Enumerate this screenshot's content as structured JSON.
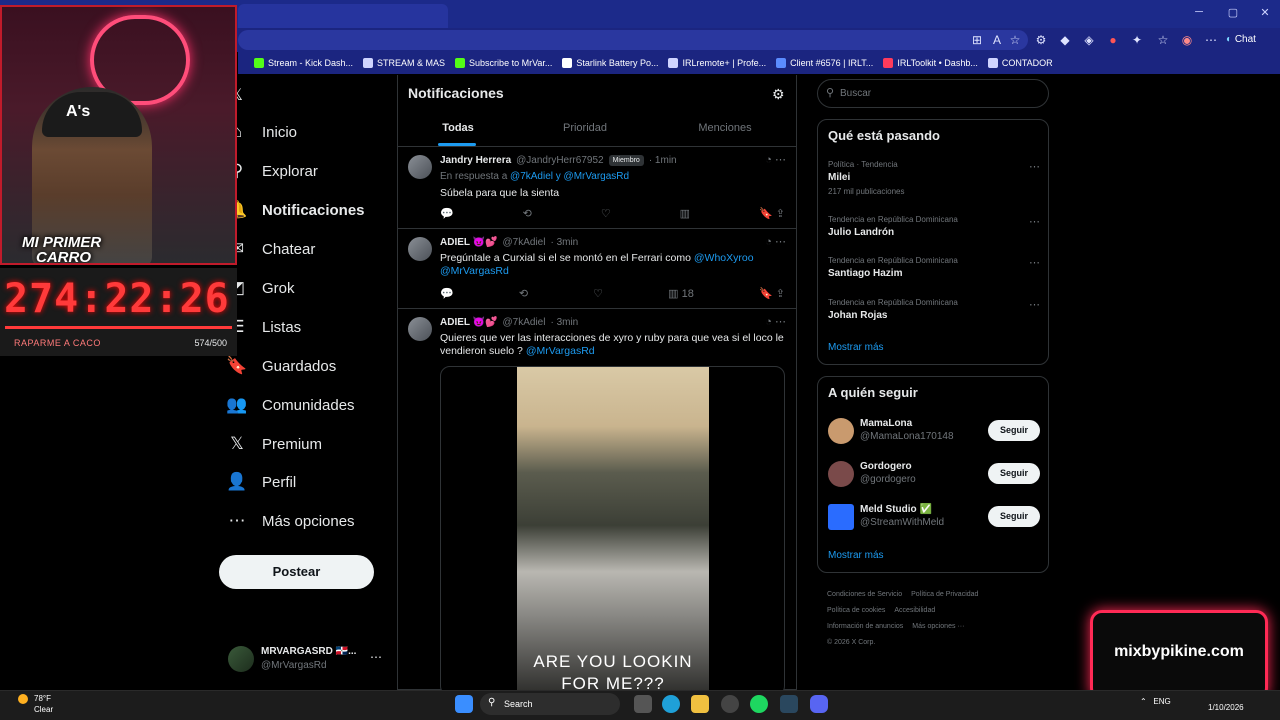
{
  "browser": {
    "chat_label": "Chat",
    "bookmarks": [
      {
        "label": "Stream - Kick Dash...",
        "color": "#53fc18"
      },
      {
        "label": "STREAM & MAS",
        "color": "#cfd4ff"
      },
      {
        "label": "Subscribe to MrVar...",
        "color": "#53fc18"
      },
      {
        "label": "Starlink Battery Po...",
        "color": "#ffffff"
      },
      {
        "label": "IRLremote+ | Profe...",
        "color": "#cfd4ff"
      },
      {
        "label": "Client #6576 | IRLT...",
        "color": "#5b8cff"
      },
      {
        "label": "IRLToolkit • Dashb...",
        "color": "#ff3b5c"
      },
      {
        "label": "CONTADOR",
        "color": "#cfd4ff"
      }
    ]
  },
  "nav": {
    "items": [
      {
        "label": "Inicio",
        "icon": "home-icon",
        "glyph": "⌂"
      },
      {
        "label": "Explorar",
        "icon": "search-icon",
        "glyph": "⚲"
      },
      {
        "label": "Notificaciones",
        "icon": "bell-icon",
        "glyph": "🔔"
      },
      {
        "label": "Chatear",
        "icon": "envelope-icon",
        "glyph": "✉"
      },
      {
        "label": "Grok",
        "icon": "grok-icon",
        "glyph": "◩"
      },
      {
        "label": "Listas",
        "icon": "list-icon",
        "glyph": "☰"
      },
      {
        "label": "Guardados",
        "icon": "bookmark-icon",
        "glyph": "🔖"
      },
      {
        "label": "Comunidades",
        "icon": "people-icon",
        "glyph": "👥"
      },
      {
        "label": "Premium",
        "icon": "x-logo-icon",
        "glyph": "𝕏"
      },
      {
        "label": "Perfil",
        "icon": "person-icon",
        "glyph": "👤"
      },
      {
        "label": "Más opciones",
        "icon": "more-circle-icon",
        "glyph": "⋯"
      }
    ],
    "post_label": "Postear",
    "account": {
      "name": "MRVARGASRD 🇩🇴...",
      "handle": "@MrVargasRd"
    }
  },
  "notifications": {
    "title": "Notificaciones",
    "tabs": [
      "Todas",
      "Prioridad",
      "Menciones"
    ],
    "posts": [
      {
        "name": "Jandry Herrera",
        "handle": "@JandryHerr67952",
        "badge": "Miembro",
        "time": "1min",
        "reply_prefix": "En respuesta a",
        "reply_users": "@7kAdiel y @MrVargasRd",
        "text": "Súbela para que la sienta",
        "views": ""
      },
      {
        "name": "ADIEL 😈💕",
        "handle": "@7kAdiel",
        "time": "3min",
        "text": "Pregúntale a Curxial si el se montó en el Ferrari como",
        "mentions": "@WhoXyroo @MrVargasRd",
        "views": "18"
      },
      {
        "name": "ADIEL 😈💕",
        "handle": "@7kAdiel",
        "time": "3min",
        "text": "Quieres que ver las interacciones de xyro y ruby para que vea si el loco le vendieron suelo ?",
        "mentions": "@MrVargasRd",
        "media_caption": "ARE YOU LOOKIN FOR ME???"
      }
    ]
  },
  "right": {
    "search_placeholder": "Buscar",
    "trends_title": "Qué está pasando",
    "trends": [
      {
        "meta": "Política · Tendencia",
        "name": "Milei",
        "count": "217 mil publicaciones"
      },
      {
        "meta": "Tendencia en República Dominicana",
        "name": "Julio Landrón",
        "count": ""
      },
      {
        "meta": "Tendencia en República Dominicana",
        "name": "Santiago Hazim",
        "count": ""
      },
      {
        "meta": "Tendencia en República Dominicana",
        "name": "Johan Rojas",
        "count": ""
      }
    ],
    "show_more": "Mostrar más",
    "follow_title": "A quién seguir",
    "follow": [
      {
        "name": "MamaLona",
        "handle": "@MamaLona170148",
        "button": "Seguir",
        "color": "#c99a6e"
      },
      {
        "name": "Gordogero",
        "handle": "@gordogero",
        "button": "Seguir",
        "color": "#7a4a4a"
      },
      {
        "name": "Meld Studio ✅",
        "handle": "@StreamWithMeld",
        "button": "Seguir",
        "color": "#2a6cff"
      }
    ],
    "footer": [
      "Condiciones de Servicio",
      "Política de Privacidad",
      "Política de cookies",
      "Accesibilidad",
      "Información de anuncios",
      "Más opciones ···",
      "© 2026 X Corp."
    ]
  },
  "overlay": {
    "cam_label_1": "MI PRIMER",
    "cam_label_2": "CARRO",
    "cap_logo": "A's",
    "timer": "274:22:26",
    "goal_label": "RAPARME A CACO",
    "goal_count": "574/500",
    "goal_progress": 1.0,
    "brand": "mixbypikine.com"
  },
  "taskbar": {
    "weather_temp": "78°F",
    "weather_desc": "Clear",
    "search": "Search",
    "lang": "ENG",
    "date": "1/10/2026"
  }
}
